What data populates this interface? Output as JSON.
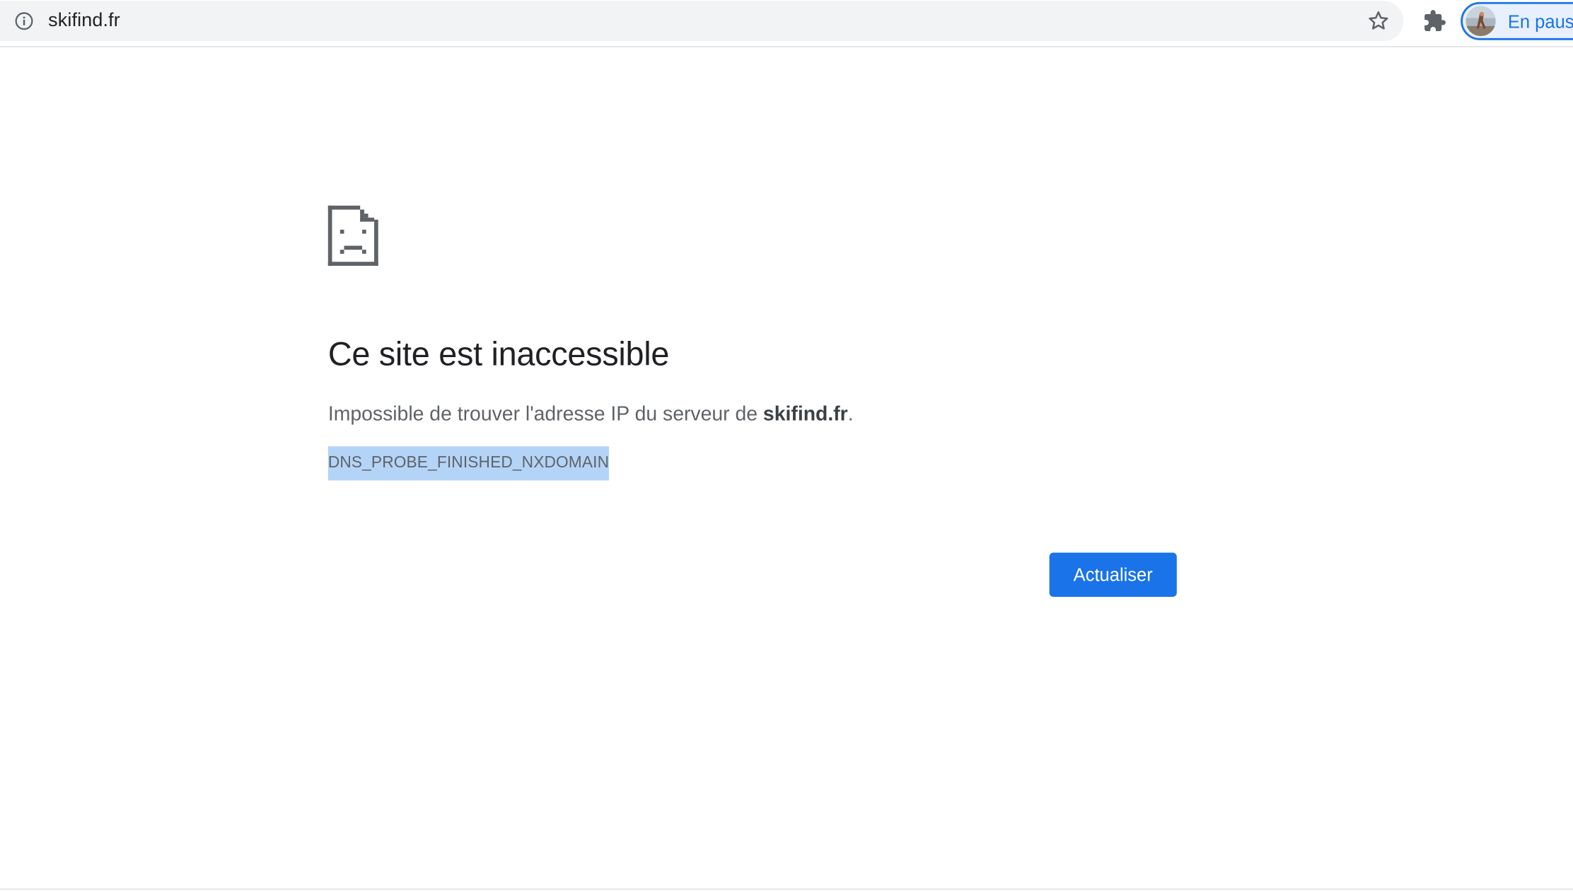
{
  "toolbar": {
    "url": "skifind.fr",
    "profile_label": "En pause",
    "icons": {
      "site_info": "info-icon",
      "bookmark": "star-icon",
      "extensions": "puzzle-icon",
      "avatar": "avatar"
    }
  },
  "error_page": {
    "icon": "sad-document-icon",
    "title": "Ce site est inaccessible",
    "summary_prefix": "Impossible de trouver l'adresse IP du serveur de ",
    "summary_host": "skifind.fr",
    "summary_suffix": ".",
    "error_code": "DNS_PROBE_FINISHED_NXDOMAIN",
    "error_code_selected": true,
    "reload_label": "Actualiser"
  },
  "colors": {
    "accent": "#1a73e8",
    "selection": "#b4d4f7",
    "omnibox_bg": "#f1f3f4",
    "text_primary": "#202124",
    "text_secondary": "#5f6368"
  }
}
